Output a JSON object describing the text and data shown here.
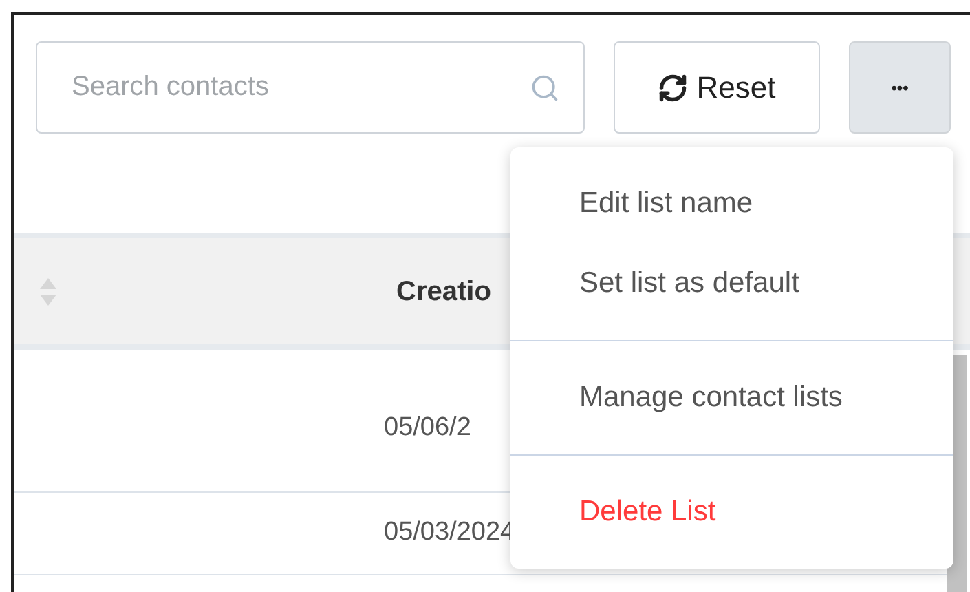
{
  "search": {
    "placeholder": "Search contacts"
  },
  "reset_button": {
    "label": "Reset"
  },
  "more_button": {
    "label": "•••",
    "expanded": true
  },
  "table": {
    "header": {
      "column_2": "Creatio"
    },
    "rows": [
      {
        "column_2": "05/06/2"
      },
      {
        "column_2": "05/03/2024"
      }
    ]
  },
  "menu": {
    "groups": [
      [
        {
          "label": "Edit list name",
          "kind": "item"
        },
        {
          "label": "Set list as default",
          "kind": "item"
        }
      ],
      [
        {
          "label": "Manage contact lists",
          "kind": "item"
        }
      ],
      [
        {
          "label": "Delete List",
          "kind": "danger"
        }
      ]
    ]
  }
}
